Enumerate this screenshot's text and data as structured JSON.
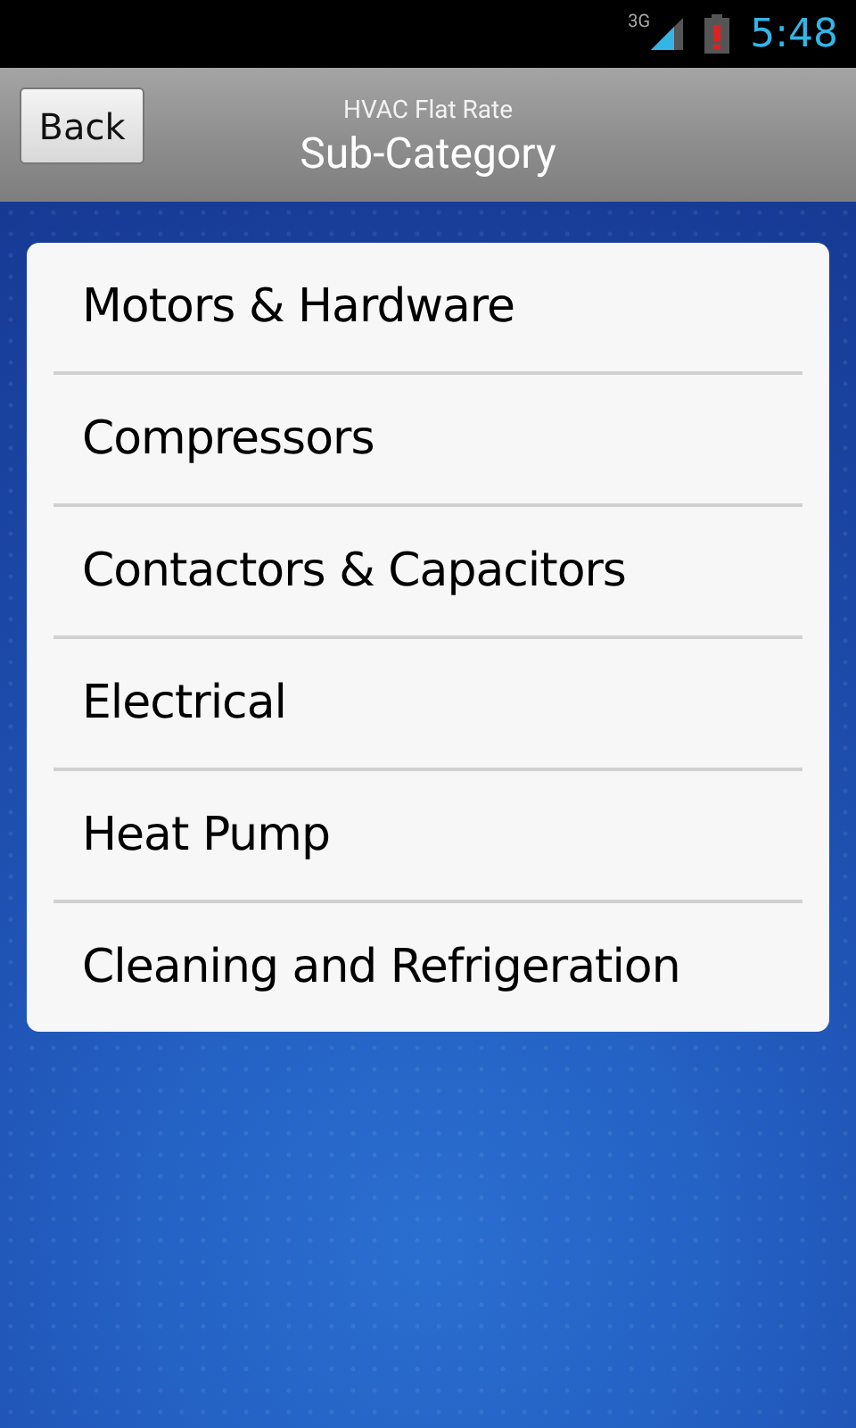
{
  "status_bar": {
    "network": "3G",
    "time": "5:48"
  },
  "header": {
    "back_button": "Back",
    "app_name": "HVAC Flat Rate",
    "title": "Sub-Category"
  },
  "items": [
    {
      "label": "Motors & Hardware"
    },
    {
      "label": "Compressors"
    },
    {
      "label": "Contactors & Capacitors"
    },
    {
      "label": "Electrical"
    },
    {
      "label": "Heat Pump"
    },
    {
      "label": "Cleaning and Refrigeration"
    }
  ]
}
